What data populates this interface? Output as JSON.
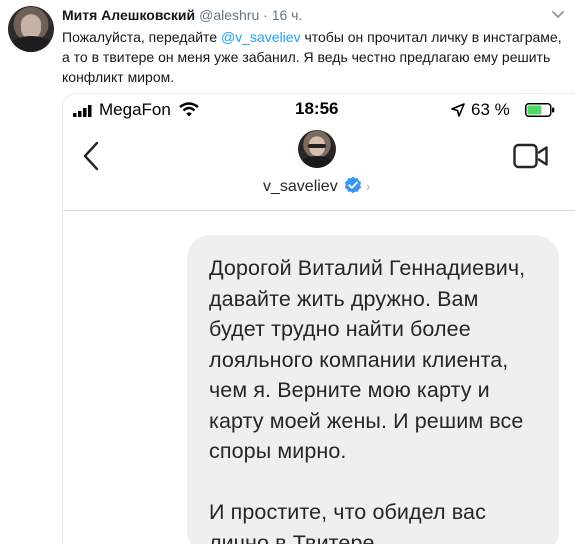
{
  "tweet": {
    "author_name": "Митя Алешковский",
    "handle": "@aleshru",
    "separator": " · ",
    "time": "16 ч.",
    "text_before_mention": "Пожалуйста, передайте ",
    "mention": "@v_saveliev",
    "text_after_mention": " чтобы он прочитал личку в инстаграме, а то в твитере он меня уже забанил. Я ведь честно предлагаю ему решить конфликт миром."
  },
  "phone": {
    "carrier": "MegaFon",
    "clock": "18:56",
    "battery_percent": "63 %",
    "battery_level": 0.63
  },
  "chat_header": {
    "contact_name": "v_saveliev",
    "chevron": "›"
  },
  "message": {
    "text": "Дорогой Виталий Геннадиевич,\nдавайте жить дружно. Вам\nбудет трудно найти более\nлояльного компании клиента,\nчем я. Верните мою карту и\nкарту моей жены. И решим все\nспоры мирно.\n\nИ простите, что обидел вас\nлично в Твитере."
  },
  "colors": {
    "link": "#1da1f2",
    "verified": "#3897f0",
    "bubble": "#efefef",
    "battery_fill": "#4cd964"
  },
  "icons": {
    "tweet_menu": "chevron-down-icon",
    "signal": "signal-bars-icon",
    "wifi": "wifi-icon",
    "location": "location-arrow-icon",
    "battery": "battery-icon",
    "back": "back-chevron-icon",
    "video": "video-camera-icon",
    "verified": "verified-badge-icon"
  }
}
